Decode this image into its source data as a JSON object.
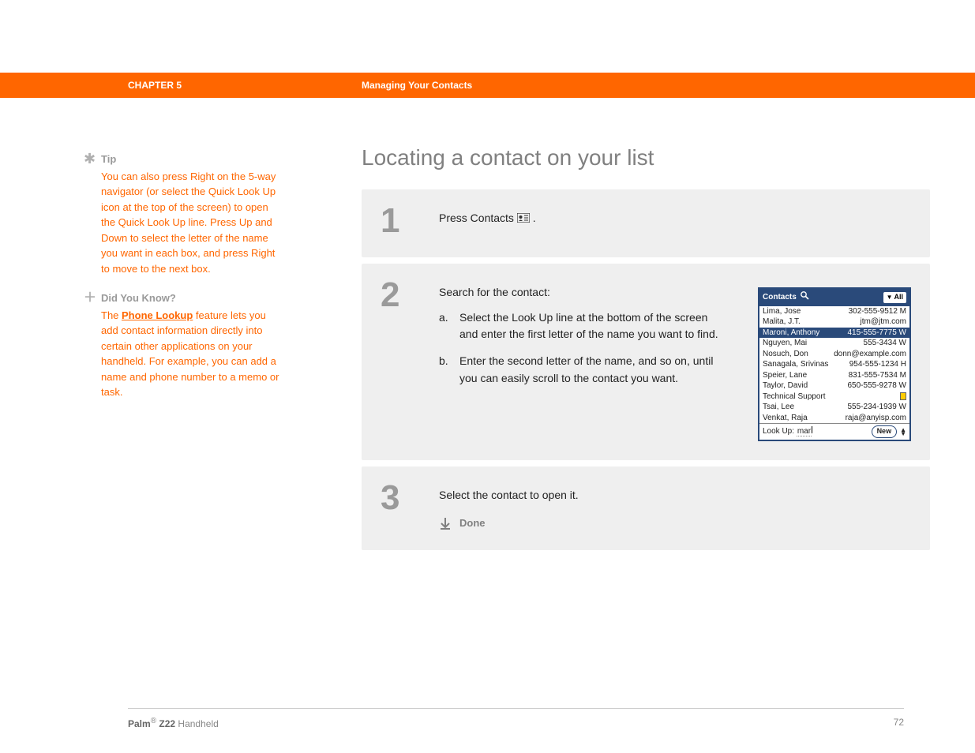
{
  "header": {
    "chapter": "CHAPTER 5",
    "topic": "Managing Your Contacts"
  },
  "sidebar": {
    "tip": {
      "title": "Tip",
      "body": "You can also press Right on the 5-way navigator (or select the Quick Look Up icon at the top of the screen) to open the Quick Look Up line. Press Up and Down to select the letter of the name you want in each box, and press Right to move to the next box."
    },
    "dyk": {
      "title": "Did You Know?",
      "pre": "The ",
      "link": "Phone Lookup",
      "post": " feature lets you add contact information directly into certain other applications on your handheld. For example, you can add a name and phone number to a memo or task."
    }
  },
  "main": {
    "title": "Locating a contact on your list",
    "step1": {
      "num": "1",
      "text_pre": "Press Contacts ",
      "text_post": "."
    },
    "step2": {
      "num": "2",
      "lead": "Search for the contact:",
      "a_letter": "a.",
      "a_text": "Select the Look Up line at the bottom of the screen and enter the first letter of the name you want to find.",
      "b_letter": "b.",
      "b_text": "Enter the second letter of the name, and so on, until you can easily scroll to the contact you want."
    },
    "step3": {
      "num": "3",
      "text": "Select the contact to open it.",
      "done": "Done"
    }
  },
  "palm": {
    "title": "Contacts",
    "dropdown": "All",
    "rows": [
      {
        "name": "Lima, Jose",
        "val": "302-555-9512 M",
        "sel": false
      },
      {
        "name": "Malita, J.T.",
        "val": "jtm@jtm.com",
        "sel": false
      },
      {
        "name": "Maroni, Anthony",
        "val": "415-555-7775 W",
        "sel": true
      },
      {
        "name": "Nguyen, Mai",
        "val": "555-3434 W",
        "sel": false
      },
      {
        "name": "Nosuch, Don",
        "val": "donn@example.com",
        "sel": false
      },
      {
        "name": "Sanagala, Srivinas",
        "val": "954-555-1234 H",
        "sel": false
      },
      {
        "name": "Speier, Lane",
        "val": "831-555-7534 M",
        "sel": false
      },
      {
        "name": "Taylor, David",
        "val": "650-555-9278 W",
        "sel": false
      },
      {
        "name": "Technical Support",
        "val": "",
        "sel": false,
        "flag": true
      },
      {
        "name": "Tsai, Lee",
        "val": "555-234-1939 W",
        "sel": false
      },
      {
        "name": "Venkat, Raja",
        "val": "raja@anyisp.com",
        "sel": false
      }
    ],
    "lookup_label": "Look Up:",
    "lookup_value": "mar",
    "new_btn": "New"
  },
  "footer": {
    "product_bold": "Palm",
    "product_reg": "®",
    "product_model": " Z22",
    "product_type": " Handheld",
    "page": "72"
  }
}
